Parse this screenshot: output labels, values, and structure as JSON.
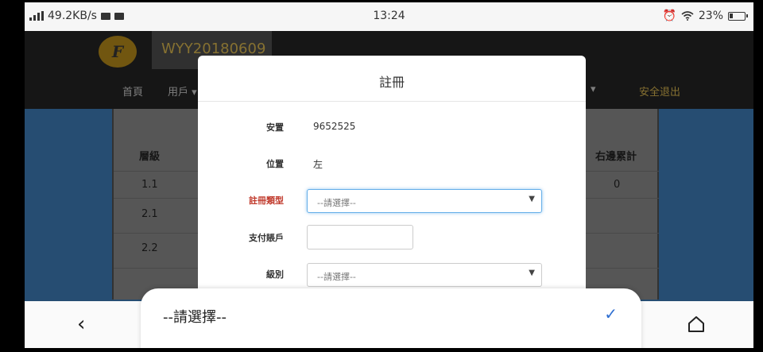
{
  "status_bar": {
    "network_speed": "49.2KB/s",
    "time": "13:24",
    "battery": "23%",
    "icons": [
      "signal-icon",
      "video-icon",
      "alarm-icon",
      "wifi-icon",
      "battery-icon"
    ]
  },
  "site": {
    "logo_text": "F",
    "username": "WYY20180609",
    "nav": [
      "首頁",
      "用戶"
    ],
    "logout": "安全退出"
  },
  "table": {
    "headers": [
      "層級",
      "右邊累計"
    ],
    "rows": [
      {
        "level": "1.1",
        "right_total": "0"
      },
      {
        "level": "2.1",
        "right_total": ""
      },
      {
        "level": "2.2",
        "right_total": ""
      }
    ]
  },
  "modal": {
    "title": "註冊",
    "fields": {
      "placement_label": "安置",
      "placement_value": "9652525",
      "position_label": "位置",
      "position_value": "左",
      "register_type_label": "註冊類型",
      "register_type_value": "--請選擇--",
      "payment_account_label": "支付賬戶",
      "level_label": "級別",
      "level_value": "--請選擇--"
    }
  },
  "picker": {
    "selected": "--請選擇--"
  },
  "colors": {
    "required_label": "#c0392b",
    "check_accent": "#2f6fd1",
    "brand_gold": "#a48a3c"
  }
}
